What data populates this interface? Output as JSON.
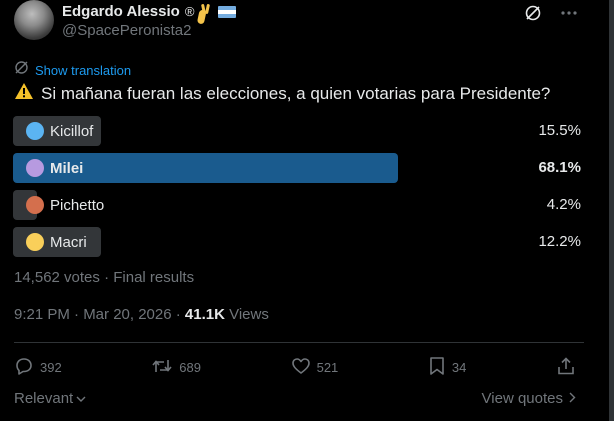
{
  "author": {
    "name": "Edgardo Alessio",
    "registered_mark": "®",
    "handle": "@SpacePeronista2",
    "flag_colors": [
      "#74acdf",
      "#ffffff",
      "#74acdf"
    ]
  },
  "tweet": {
    "show_translation": "Show translation",
    "question": "Si mañana fueran las elecciones, a quien votarias para Presidente?"
  },
  "poll": {
    "options": [
      {
        "label": "Kicillof",
        "pct": "15.5%",
        "value": 15.5,
        "dot_color": "#5bb4f2",
        "winner": false
      },
      {
        "label": "Milei",
        "pct": "68.1%",
        "value": 68.1,
        "dot_color": "#b79ae0",
        "winner": true
      },
      {
        "label": "Pichetto",
        "pct": "4.2%",
        "value": 4.2,
        "dot_color": "#d46f4d",
        "winner": false
      },
      {
        "label": "Macri",
        "pct": "12.2%",
        "value": 12.2,
        "dot_color": "#f9cf5a",
        "winner": false
      }
    ],
    "votes_line": "14,562 votes · Final results"
  },
  "meta": {
    "time": "9:21 PM · Mar 20, 2026 · ",
    "views_count": "41.1K",
    "views_label": " Views"
  },
  "actions": {
    "replies": "392",
    "reposts": "689",
    "likes": "521",
    "bookmarks": "34"
  },
  "footer": {
    "sort": "Relevant",
    "quotes": "View quotes"
  },
  "colors": {
    "accent": "#1d9bf0",
    "winner_bar": "#1a5b8e",
    "bar": "#333639",
    "muted": "#71767b"
  }
}
